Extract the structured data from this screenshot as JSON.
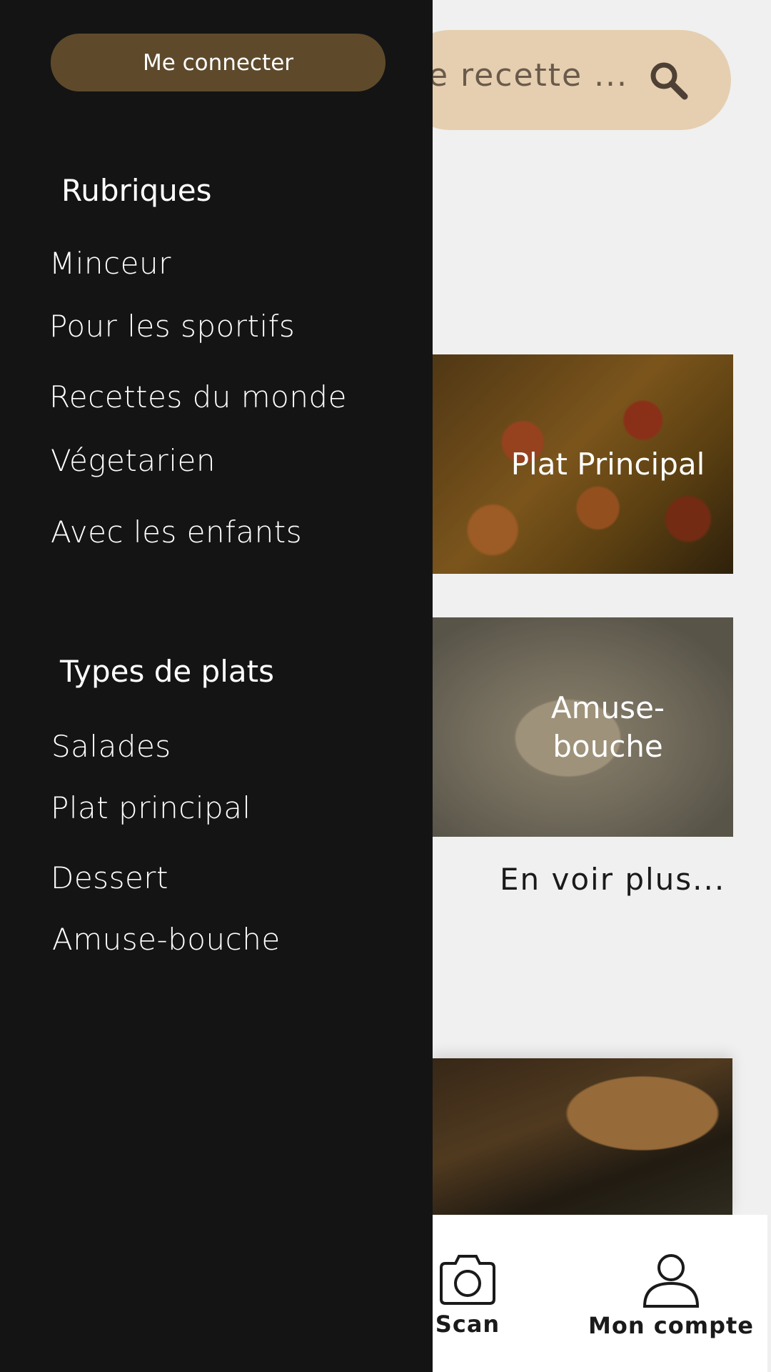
{
  "search": {
    "placeholder_visible": "e recette ..."
  },
  "cards": [
    {
      "label": "Plat Principal"
    },
    {
      "label": "Amuse-bouche"
    }
  ],
  "see_more": "En voir plus...",
  "bottom_nav": {
    "scan": "Scan",
    "account": "Mon compte"
  },
  "drawer": {
    "login": "Me connecter",
    "rubriques_title": "Rubriques",
    "rubriques": [
      "Minceur",
      "Pour les sportifs",
      "Recettes du monde",
      "Végetarien",
      "Avec les enfants"
    ],
    "types_title": "Types de plats",
    "types": [
      "Salades",
      "Plat principal",
      "Dessert",
      "Amuse-bouche"
    ]
  },
  "colors": {
    "drawer_bg": "#141414",
    "login_button": "#5e4a2b",
    "search_bar": "#e5cfb0"
  }
}
